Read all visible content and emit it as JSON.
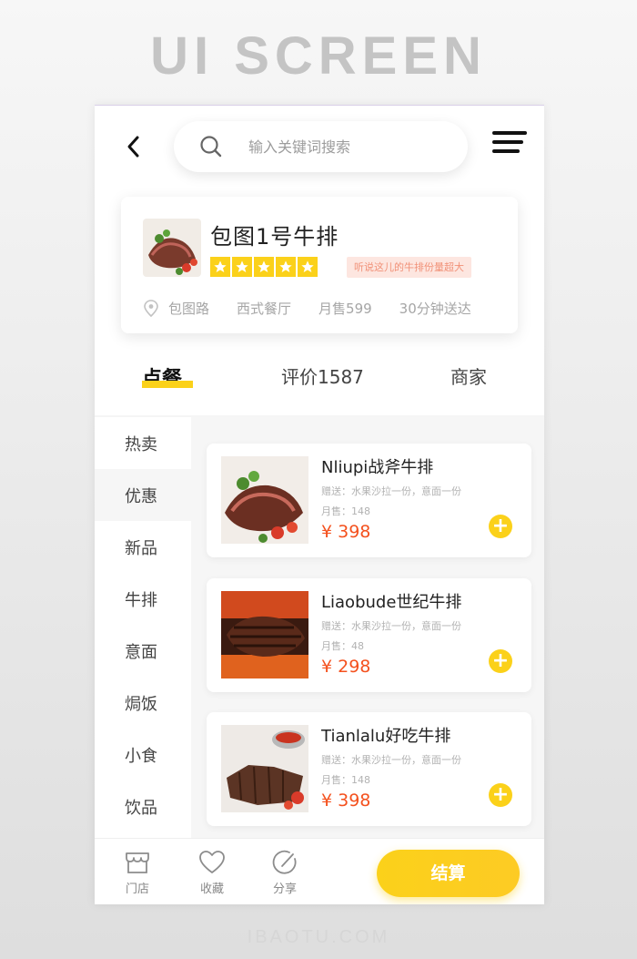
{
  "banner": {
    "title": "UI SCREEN",
    "footer": "IBAOTU.COM"
  },
  "header": {
    "search_placeholder": "输入关键词搜索"
  },
  "store": {
    "name": "包图1号牛排",
    "rating_stars": 5,
    "promo": "听说这儿的牛排份量超大",
    "location": "包图路",
    "category": "西式餐厅",
    "monthly_sales": "月售599",
    "delivery_time": "30分钟送达"
  },
  "tabs": [
    {
      "label": "点餐",
      "active": true
    },
    {
      "label": "评价1587",
      "active": false
    },
    {
      "label": "商家",
      "active": false
    }
  ],
  "categories": [
    {
      "label": "热卖",
      "selected": false
    },
    {
      "label": "优惠",
      "selected": true
    },
    {
      "label": "新品",
      "selected": false
    },
    {
      "label": "牛排",
      "selected": false
    },
    {
      "label": "意面",
      "selected": false
    },
    {
      "label": "焗饭",
      "selected": false
    },
    {
      "label": "小食",
      "selected": false
    },
    {
      "label": "饮品",
      "selected": false
    }
  ],
  "items": [
    {
      "name": "Nliupi战斧牛排",
      "gift": "赠送：水果沙拉一份，意面一份",
      "sales": "月售：148",
      "price": "¥ 398"
    },
    {
      "name": "Liaobude世纪牛排",
      "gift": "赠送：水果沙拉一份，意面一份",
      "sales": "月售：48",
      "price": "¥ 298"
    },
    {
      "name": "Tianlalu好吃牛排",
      "gift": "赠送：水果沙拉一份，意面一份",
      "sales": "月售：148",
      "price": "¥ 398"
    }
  ],
  "bottom_nav": [
    {
      "label": "门店",
      "icon": "store-icon"
    },
    {
      "label": "收藏",
      "icon": "heart-icon"
    },
    {
      "label": "分享",
      "icon": "share-icon"
    }
  ],
  "checkout_label": "结算",
  "colors": {
    "accent": "#fbd11a",
    "price": "#f4511e",
    "promo_bg": "#fde6e0",
    "promo_text": "#f19178"
  }
}
